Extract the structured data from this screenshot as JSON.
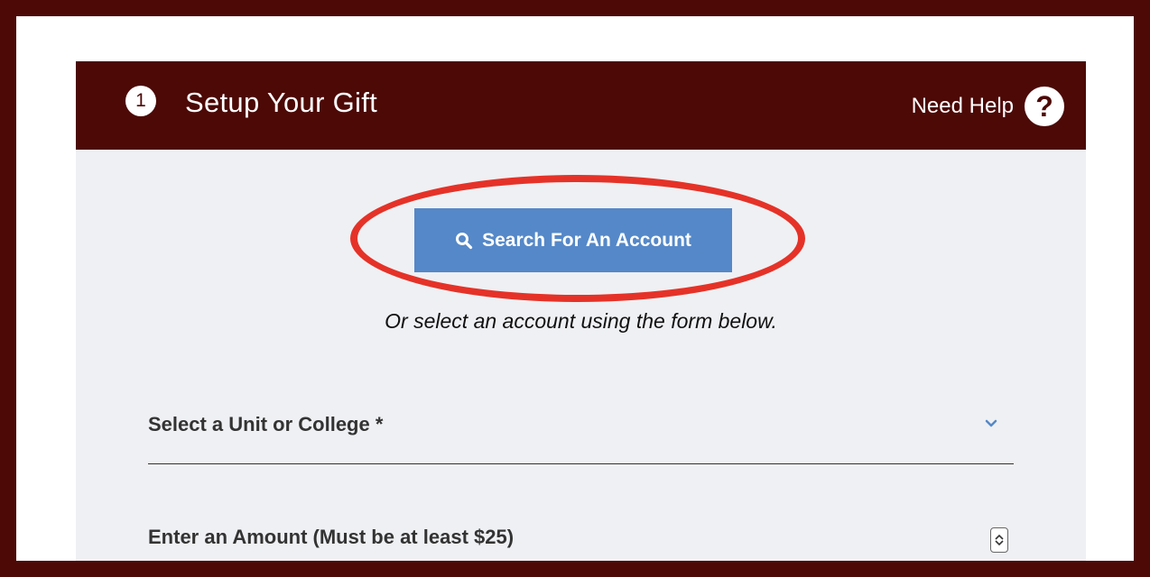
{
  "header": {
    "step_number": "1",
    "title": "Setup Your Gift",
    "help_label": "Need Help",
    "help_icon": "question-circle-icon"
  },
  "search": {
    "button_label": "Search For An Account",
    "icon": "search-icon",
    "alt_text": "Or select an account using the form below."
  },
  "form": {
    "unit_field_label": "Select a Unit or College *",
    "amount_field_label": "Enter an Amount (Must be at least $25)"
  },
  "colors": {
    "brand_maroon": "#4c0906",
    "button_blue": "#5588c8",
    "highlight_red": "#e53228",
    "card_bg": "#eff0f3"
  }
}
